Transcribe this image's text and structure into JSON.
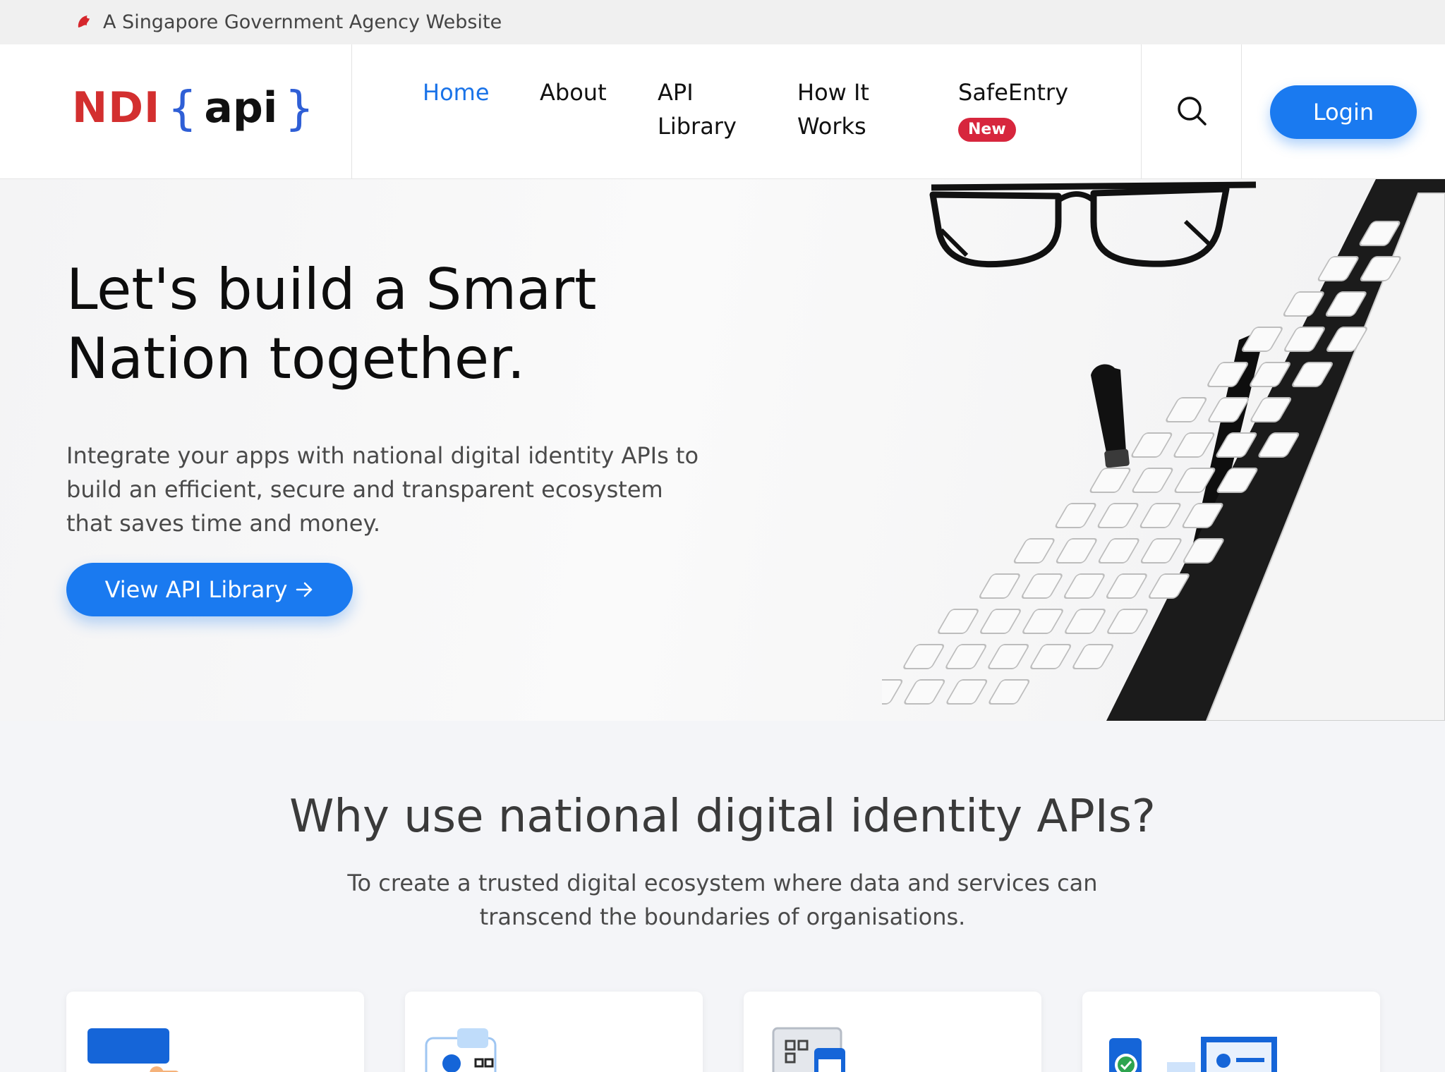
{
  "masthead": {
    "text": "A Singapore Government Agency Website",
    "icon": "lion-head-icon"
  },
  "logo": {
    "ndi": "NDI",
    "open": "{",
    "api": "api",
    "close": "}"
  },
  "nav": {
    "home": "Home",
    "about": "About",
    "api_library_1": "API",
    "api_library_2": "Library",
    "how_1": "How It",
    "how_2": "Works",
    "safeentry": "SafeEntry",
    "safeentry_badge": "New"
  },
  "header": {
    "search_icon": "search-icon",
    "login": "Login"
  },
  "hero": {
    "title_1": "Let's build a Smart",
    "title_2": "Nation together.",
    "desc_1": "Integrate your apps with national digital identity APIs to",
    "desc_2": "build an efficient, secure and transparent ecosystem",
    "desc_3": "that saves time and money.",
    "cta": "View API Library",
    "cta_icon": "arrow-right-icon"
  },
  "why": {
    "title": "Why use national digital identity APIs?",
    "sub_1": "To create a trusted digital ecosystem where data and services can",
    "sub_2": "transcend the boundaries of organisations."
  },
  "colors": {
    "primary": "#1a7af0",
    "ndi_red": "#d32f2f",
    "brace_blue": "#2f5fd6",
    "badge_red": "#d7263d"
  }
}
